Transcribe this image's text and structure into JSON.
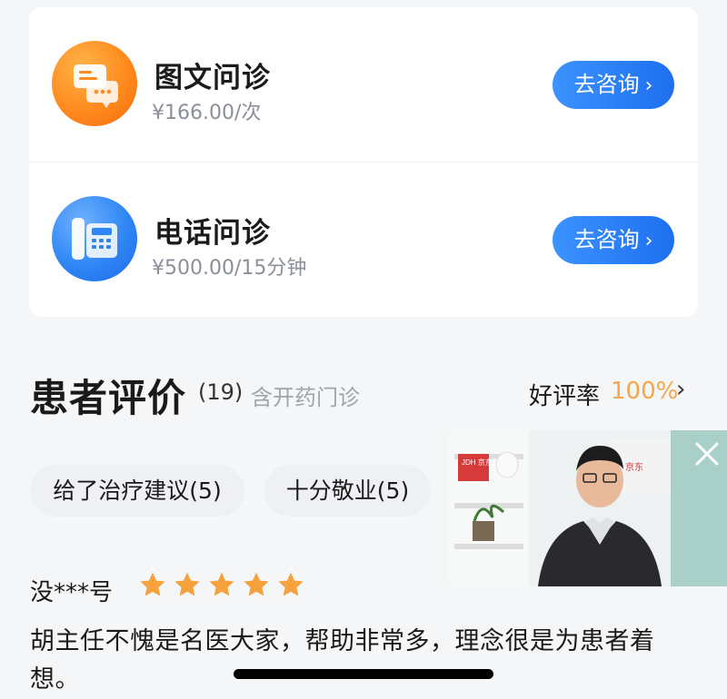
{
  "services": [
    {
      "title": "图文问诊",
      "price": "¥166.00/次",
      "button": "去咨询",
      "icon": "chat-bubbles-icon",
      "accent": "#ff8a1e"
    },
    {
      "title": "电话问诊",
      "price": "¥500.00/15分钟",
      "button": "去咨询",
      "icon": "telephone-icon",
      "accent": "#2f86f5"
    }
  ],
  "reviews": {
    "title": "患者评价",
    "count": "(19)",
    "note": "含开药门诊",
    "rate_label": "好评率",
    "rate_value": "100%",
    "tags": [
      "给了治疗建议(5)",
      "十分敬业(5)"
    ],
    "items": [
      {
        "user": "没***号",
        "rating": 5,
        "text": "胡主任不愧是名医大家，帮助非常多，理念很是为患者着想。"
      }
    ]
  },
  "video": {
    "sign_left": "JDH 京东健康",
    "sign_right": "京东"
  },
  "colors": {
    "button": "#1e6fef",
    "rating": "#f5a64a",
    "star": "#f5a23d"
  }
}
